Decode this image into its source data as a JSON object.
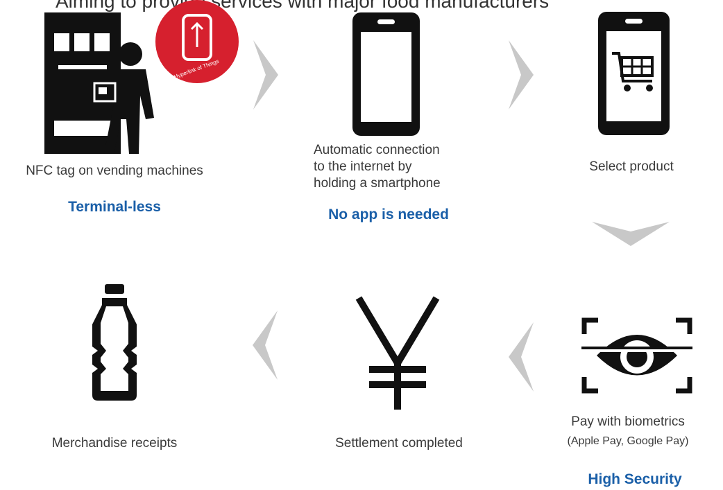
{
  "title": "Aiming to provide services with major food manufacturers",
  "steps": {
    "s1": {
      "label": "NFC tag on vending machines",
      "highlight": "Terminal-less",
      "badge_text": "Hyperlink of Things"
    },
    "s2": {
      "label_lines": [
        "Automatic connection",
        "to the internet by",
        "holding a smartphone"
      ],
      "highlight": "No app is needed"
    },
    "s3": {
      "label": "Select product"
    },
    "s4": {
      "label": "Pay with biometrics",
      "sublabel": "(Apple Pay, Google Pay)",
      "highlight": "High Security"
    },
    "s5": {
      "label": "Settlement completed"
    },
    "s6": {
      "label": "Merchandise receipts"
    }
  },
  "colors": {
    "accent": "#1a5fa8",
    "arrow": "#c8c8c8",
    "badge": "#d6202e",
    "icon": "#111111"
  },
  "icons": [
    "vending-machine-icon",
    "person-icon",
    "nfc-badge-icon",
    "smartphone-icon",
    "cart-phone-icon",
    "eye-scan-icon",
    "yen-icon",
    "bottle-icon"
  ]
}
